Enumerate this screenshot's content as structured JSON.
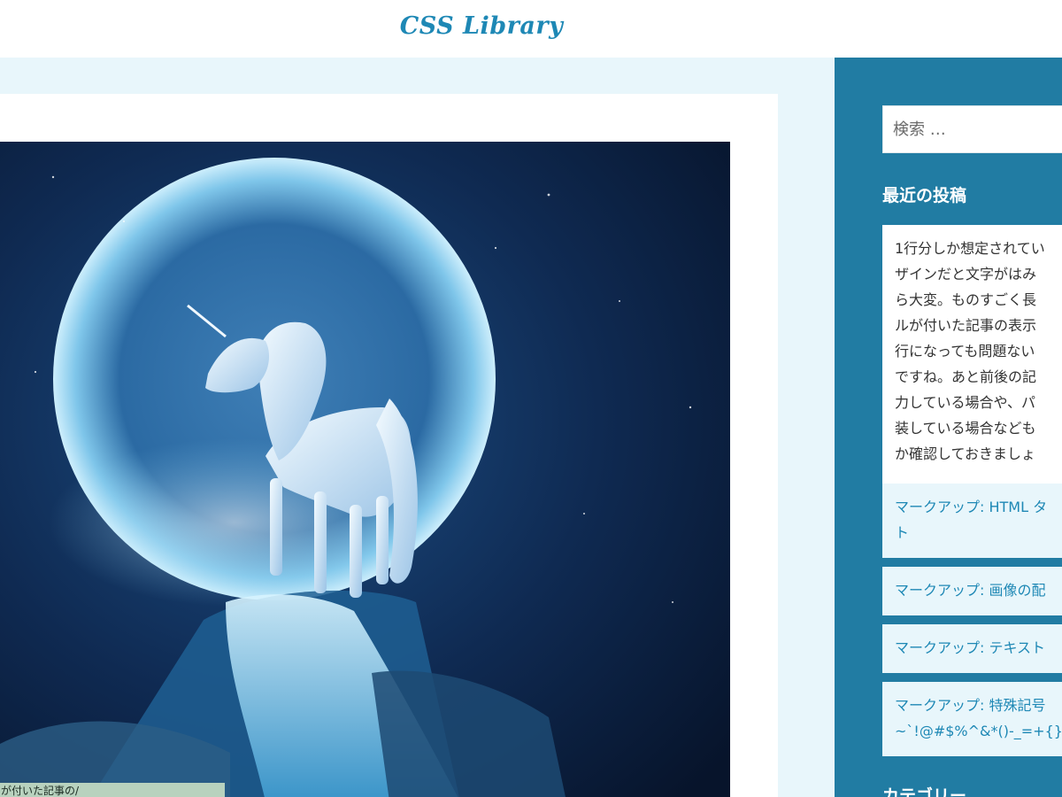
{
  "header": {
    "logo": "CSS Library"
  },
  "hero": {
    "caption": "が付いた記事の/"
  },
  "sidebar": {
    "search_placeholder": "検索 …",
    "recent_title": "最近の投稿",
    "posts": [
      {
        "lines": [
          "1行分しか想定されてい",
          "ザインだと文字がはみ",
          "ら大変。ものすごく長",
          "ルが付いた記事の表示",
          "行になっても問題ない",
          "ですね。あと前後の記",
          "力している場合や、パ",
          "装している場合なども",
          "か確認しておきましょ"
        ]
      },
      {
        "lines": [
          "マークアップ: HTML タ",
          "ト"
        ]
      },
      {
        "lines": [
          "マークアップ: 画像の配"
        ]
      },
      {
        "lines": [
          "マークアップ: テキスト"
        ]
      },
      {
        "lines": [
          "マークアップ: 特殊記号",
          "~`!@#$%^&*()-_=+{}"
        ]
      }
    ],
    "category_title": "カテゴリー"
  }
}
